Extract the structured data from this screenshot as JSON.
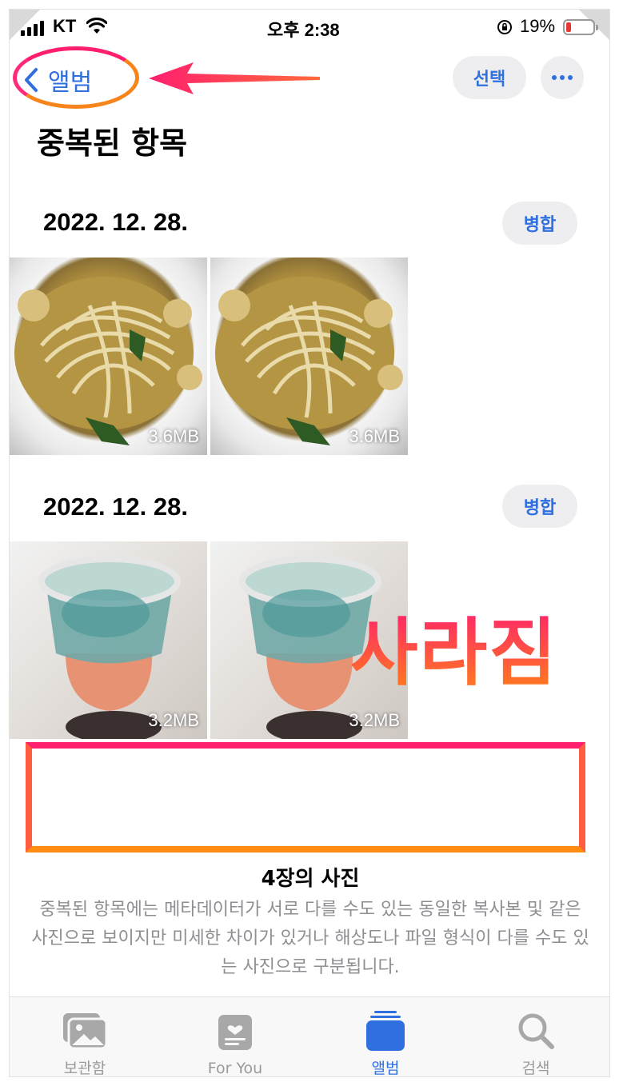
{
  "status_bar": {
    "carrier": "KT",
    "time": "오후 2:38",
    "battery_percent": "19%",
    "battery_level": 0.19
  },
  "nav": {
    "back_label": "앨범",
    "select_label": "선택"
  },
  "page": {
    "title": "중복된 항목"
  },
  "groups": [
    {
      "date": "2022. 12. 28.",
      "merge_label": "병합",
      "photos": [
        {
          "size": "3.6MB"
        },
        {
          "size": "3.6MB"
        }
      ]
    },
    {
      "date": "2022. 12. 28.",
      "merge_label": "병합",
      "photos": [
        {
          "size": "3.2MB"
        },
        {
          "size": "3.2MB"
        }
      ]
    }
  ],
  "annotation": {
    "overlay_text": "사라짐"
  },
  "footer": {
    "count": "4장의 사진",
    "description": "중복된 항목에는 메타데이터가 서로 다를 수도 있는 동일한 복사본 및 같은 사진으로 보이지만 미세한 차이가 있거나 해상도나 파일 형식이 다를 수도 있는 사진으로 구분됩니다."
  },
  "tabs": [
    {
      "label": "보관함",
      "icon": "photo-library-icon",
      "active": false
    },
    {
      "label": "For You",
      "icon": "for-you-icon",
      "active": false
    },
    {
      "label": "앨범",
      "icon": "albums-icon",
      "active": true
    },
    {
      "label": "검색",
      "icon": "search-icon",
      "active": false
    }
  ],
  "colors": {
    "accent": "#2f6fe0",
    "annotation_pink": "#ff1f6f",
    "annotation_orange": "#ff8c10"
  }
}
